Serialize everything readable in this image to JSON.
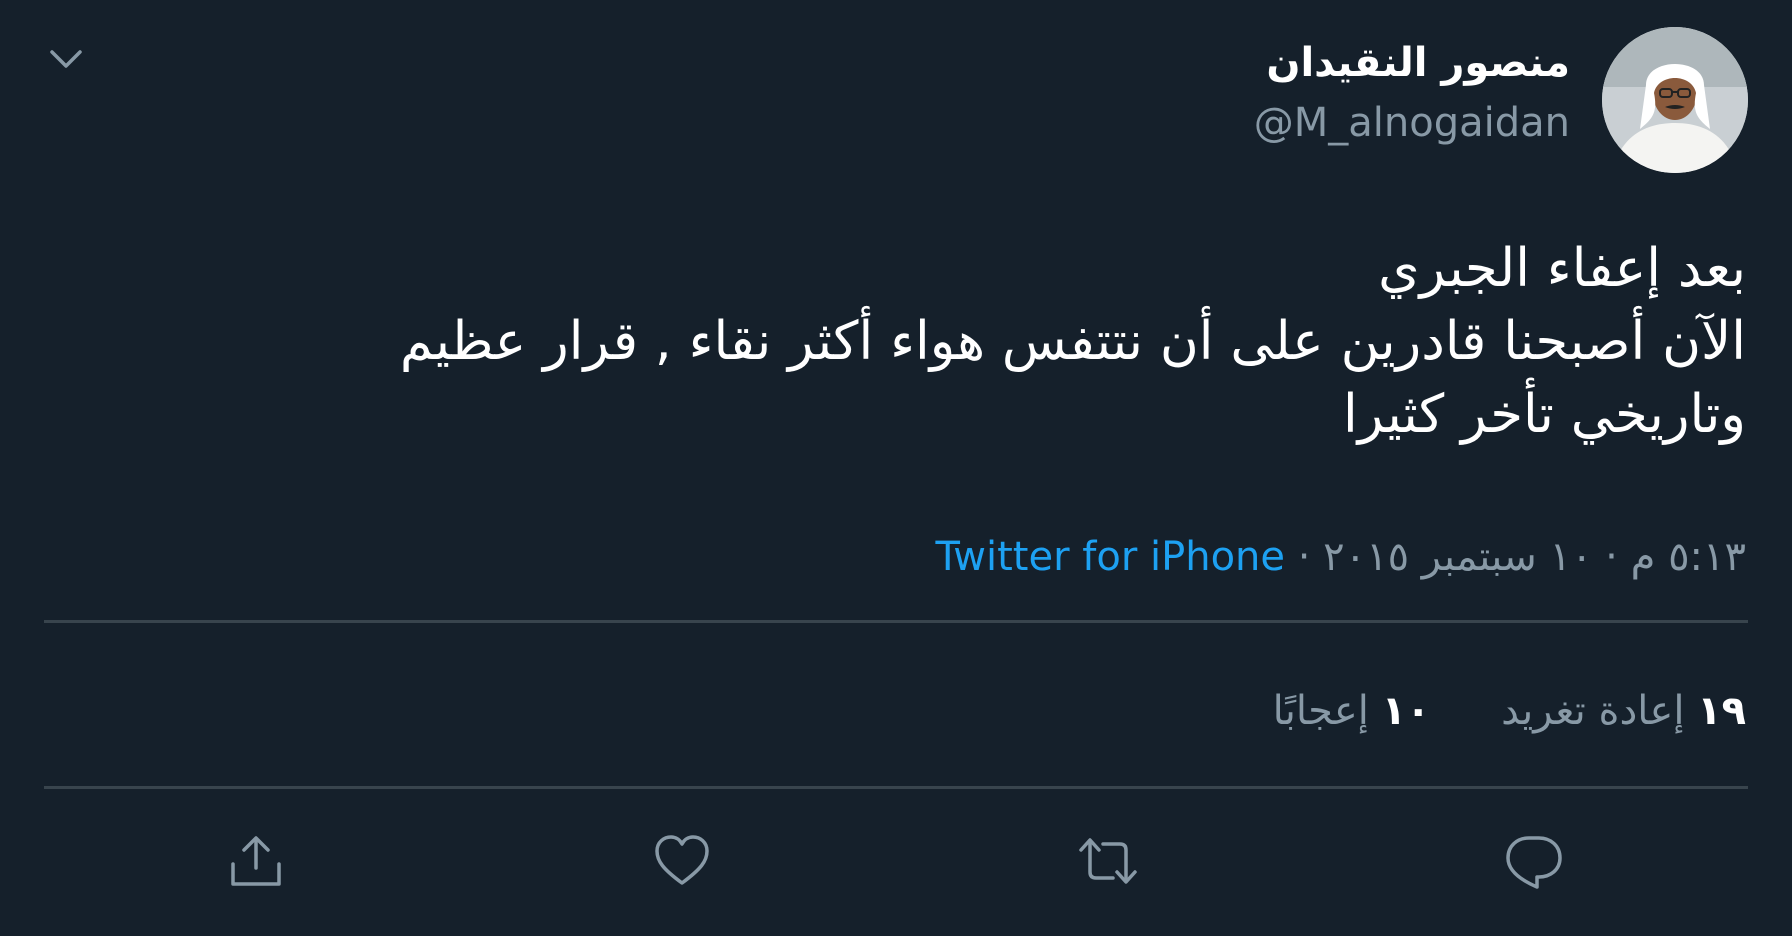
{
  "author": {
    "name": "منصور النقيدان",
    "handle": "@M_alnogaidan"
  },
  "tweet": {
    "lines": [
      "بعد إعفاء الجبري",
      "الآن أصبحنا قادرين على أن نتتفس هواء أكثر نقاء , قرار عظيم",
      "وتاريخي تأخر كثيرا"
    ]
  },
  "meta": {
    "time": "٥:١٣ م",
    "separator": "·",
    "date": "١٠ سبتمبر ٢٠١٥",
    "source": "Twitter for iPhone"
  },
  "stats": {
    "retweets_count": "١٩",
    "retweets_label": "إعادة تغريد",
    "likes_count": "١٠",
    "likes_label": "إعجابًا"
  },
  "icons": [
    "chevron-down-icon",
    "reply-icon",
    "retweet-icon",
    "like-icon",
    "share-icon"
  ],
  "colors": {
    "background": "#15202b",
    "secondary_text": "#8899a6",
    "link": "#1da1f2",
    "divider": "#38444d"
  }
}
